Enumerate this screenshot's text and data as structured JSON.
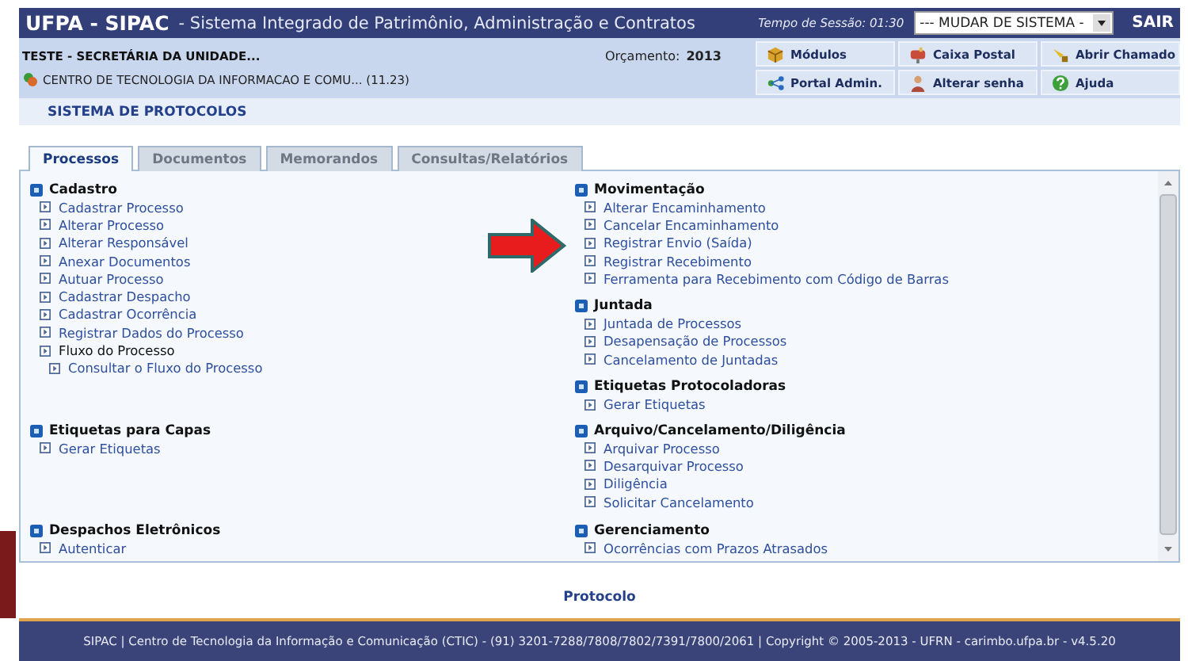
{
  "header": {
    "brand": "UFPA - SIPAC",
    "subtitle": "- Sistema Integrado de Patrimônio, Administração e Contratos",
    "session": "Tempo de Sessão: 01:30",
    "system_select": "--- MUDAR DE SISTEMA -",
    "logout": "SAIR"
  },
  "info": {
    "user": "TESTE - SECRETÁRIA DA UNIDADE...",
    "unit": "CENTRO DE TECNOLOGIA DA INFORMACAO E COMU... (11.23)",
    "budget_label": "Orçamento:",
    "budget_year": "2013"
  },
  "shortcuts": [
    {
      "kind": "modules",
      "label": "Módulos"
    },
    {
      "kind": "mail",
      "label": "Caixa Postal"
    },
    {
      "kind": "ticket",
      "label": "Abrir Chamado"
    },
    {
      "kind": "portal",
      "label": "Portal Admin."
    },
    {
      "kind": "password",
      "label": "Alterar senha"
    },
    {
      "kind": "help",
      "label": "Ajuda"
    }
  ],
  "system_title": "SISTEMA DE PROTOCOLOS",
  "tabs": [
    {
      "label": "Processos",
      "selected": true
    },
    {
      "label": "Documentos",
      "selected": false
    },
    {
      "label": "Memorandos",
      "selected": false
    },
    {
      "label": "Consultas/Relatórios",
      "selected": false
    }
  ],
  "panel": {
    "rows": [
      {
        "left": [
          {
            "title": "Cadastro",
            "items": [
              {
                "kind": "link",
                "label": "Cadastrar Processo"
              },
              {
                "kind": "link",
                "label": "Alterar Processo"
              },
              {
                "kind": "link",
                "label": "Alterar Responsável"
              },
              {
                "kind": "link",
                "label": "Anexar Documentos"
              },
              {
                "kind": "link",
                "label": "Autuar Processo"
              },
              {
                "kind": "link",
                "label": "Cadastrar Despacho"
              },
              {
                "kind": "link",
                "label": "Cadastrar Ocorrência"
              },
              {
                "kind": "link",
                "label": "Registrar Dados do Processo"
              },
              {
                "kind": "group",
                "label": "Fluxo do Processo",
                "children": [
                  {
                    "kind": "link",
                    "label": "Consultar o Fluxo do Processo"
                  }
                ]
              }
            ]
          }
        ],
        "right": [
          {
            "title": "Movimentação",
            "items": [
              {
                "kind": "link",
                "label": "Alterar Encaminhamento"
              },
              {
                "kind": "link",
                "label": "Cancelar Encaminhamento"
              },
              {
                "kind": "link",
                "label": "Registrar Envio (Saída)"
              },
              {
                "kind": "link",
                "label": "Registrar Recebimento"
              },
              {
                "kind": "link",
                "label": "Ferramenta para Recebimento com Código de Barras"
              }
            ]
          },
          {
            "title": "Juntada",
            "items": [
              {
                "kind": "link",
                "label": "Juntada de Processos"
              },
              {
                "kind": "link",
                "label": "Desapensação de Processos"
              },
              {
                "kind": "link",
                "label": "Cancelamento de Juntadas"
              }
            ]
          },
          {
            "title": "Etiquetas Protocoladoras",
            "items": [
              {
                "kind": "link",
                "label": "Gerar Etiquetas"
              }
            ]
          }
        ]
      },
      {
        "left": [
          {
            "title": "Etiquetas para Capas",
            "items": [
              {
                "kind": "link",
                "label": "Gerar Etiquetas"
              }
            ]
          }
        ],
        "right": [
          {
            "title": "Arquivo/Cancelamento/Diligência",
            "items": [
              {
                "kind": "link",
                "label": "Arquivar Processo"
              },
              {
                "kind": "link",
                "label": "Desarquivar Processo"
              },
              {
                "kind": "link",
                "label": "Diligência"
              },
              {
                "kind": "link",
                "label": "Solicitar Cancelamento"
              }
            ]
          }
        ]
      },
      {
        "left": [
          {
            "title": "Despachos Eletrônicos",
            "items": [
              {
                "kind": "link",
                "label": "Autenticar"
              }
            ]
          }
        ],
        "right": [
          {
            "title": "Gerenciamento",
            "items": [
              {
                "kind": "link",
                "label": "Ocorrências com Prazos Atrasados"
              }
            ]
          }
        ]
      }
    ]
  },
  "module_link": "Protocolo",
  "footer": "SIPAC | Centro de Tecnologia da Informação e Comunicação (CTIC) - (91) 3201-7288/7808/7802/7391/7800/2061 | Copyright © 2005-2013 - UFRN - carimbo.ufpa.br - v4.5.20"
}
